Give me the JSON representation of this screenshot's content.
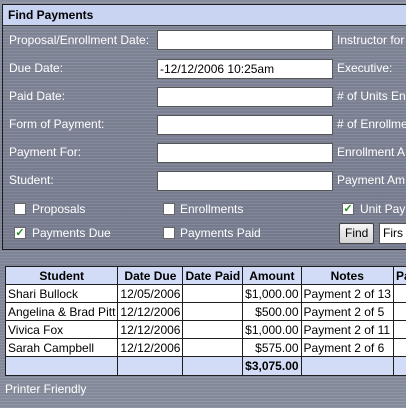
{
  "panel": {
    "title": "Find Payments",
    "labels": {
      "proposal_date": "Proposal/Enrollment Date:",
      "due_date": "Due Date:",
      "paid_date": "Paid Date:",
      "form_of_payment": "Form of Payment:",
      "payment_for": "Payment For:",
      "student": "Student:",
      "instructor": "Instructor for",
      "executive": "Executive:",
      "units": "# of Units En",
      "enrollments": "# of Enrollme",
      "enrollment_a": "Enrollment A",
      "payment_amt": "Payment Am"
    },
    "fields": {
      "proposal_date": "",
      "due_date": "-12/12/2006 10:25am",
      "paid_date": "",
      "form_of_payment": "",
      "payment_for": "",
      "student": ""
    },
    "checkboxes": {
      "proposals": {
        "label": "Proposals",
        "checked": false
      },
      "enrollments": {
        "label": "Enrollments",
        "checked": false
      },
      "unit_pay": {
        "label": "Unit Pay",
        "checked": true
      },
      "payments_due": {
        "label": "Payments Due",
        "checked": true
      },
      "payments_paid": {
        "label": "Payments Paid",
        "checked": false
      }
    },
    "find_button": "Find",
    "sort_select": "Firs"
  },
  "table": {
    "headers": [
      "Student",
      "Date Due",
      "Date Paid",
      "Amount",
      "Notes",
      "Pa"
    ],
    "rows": [
      [
        "Shari Bullock",
        "12/05/2006",
        "",
        "$1,000.00",
        "Payment 2 of 13",
        ""
      ],
      [
        "Angelina & Brad Pitt",
        "12/12/2006",
        "",
        "$500.00",
        "Payment 2 of 5",
        ""
      ],
      [
        "Vivica Fox",
        "12/12/2006",
        "",
        "$1,000.00",
        "Payment 2 of 11",
        ""
      ],
      [
        "Sarah Campbell",
        "12/12/2006",
        "",
        "$575.00",
        "Payment 2 of 6",
        ""
      ]
    ],
    "total": "$3,075.00"
  },
  "footer": {
    "printer_friendly": "Printer Friendly"
  },
  "colors": {
    "header_bg": "#c9d4f2",
    "table_header_bg": "#d2dcf6",
    "panel_bg": "#808698",
    "check_color": "#2a8a2a"
  }
}
